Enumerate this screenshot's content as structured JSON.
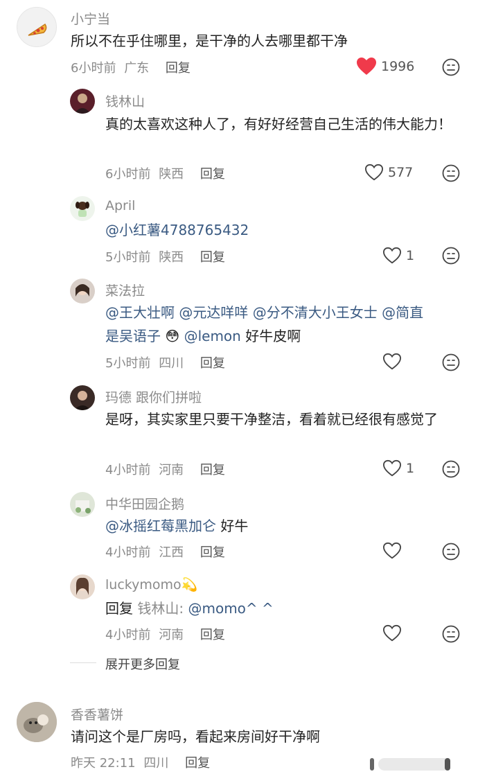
{
  "comments": [
    {
      "user": "小宁当",
      "text": "所以不在乎住哪里，是干净的人去哪里都干净",
      "time": "6小时前",
      "location": "广东",
      "reply": "回复",
      "likes": "1996",
      "liked": true,
      "replies": [
        {
          "user": "钱林山",
          "text": "真的太喜欢这种人了，有好好经营自己生活的伟大能力！",
          "time": "6小时前",
          "location": "陕西",
          "reply": "回复",
          "likes": "577"
        },
        {
          "user": "April",
          "mention": "@小红薯4788765432",
          "time": "5小时前",
          "location": "陕西",
          "reply": "回复",
          "likes": "1"
        },
        {
          "user": "菜法拉",
          "line1_m1": "@王大壮啊",
          "line1_m2": "@元达咩咩",
          "line1_m3": "@分不清大小王女士",
          "line1_m4": "@简直",
          "line2_m1": "是吴语子",
          "line2_emoji": "😳",
          "line2_m2": "@lemon",
          "line2_tail": "好牛皮啊",
          "time": "5小时前",
          "location": "四川",
          "reply": "回复",
          "likes": ""
        },
        {
          "user": "玛德 跟你们拼啦",
          "text": "是呀，其实家里只要干净整洁，看着就已经很有感觉了",
          "time": "4小时前",
          "location": "河南",
          "reply": "回复",
          "likes": "1"
        },
        {
          "user": "中华田园企鹅",
          "mention": "@冰摇红莓黑加仑",
          "tail": "好牛",
          "time": "4小时前",
          "location": "江西",
          "reply": "回复",
          "likes": ""
        },
        {
          "user": "luckymomo",
          "user_emoji": "💫",
          "reply_prefix": "回复",
          "reply_to": "钱林山:",
          "mention": "@momo^ ^",
          "time": "4小时前",
          "location": "河南",
          "reply": "回复",
          "likes": ""
        }
      ],
      "expand_more": "展开更多回复"
    },
    {
      "user": "香香薯饼",
      "text": "请问这个是厂房吗，看起来房间好干净啊",
      "time": "昨天 22:11",
      "location": "四川",
      "reply": "回复"
    }
  ],
  "colors": {
    "like_red": "#f03a4b",
    "mention_blue": "#3a5a82",
    "meta_gray": "#8a8a8a"
  }
}
